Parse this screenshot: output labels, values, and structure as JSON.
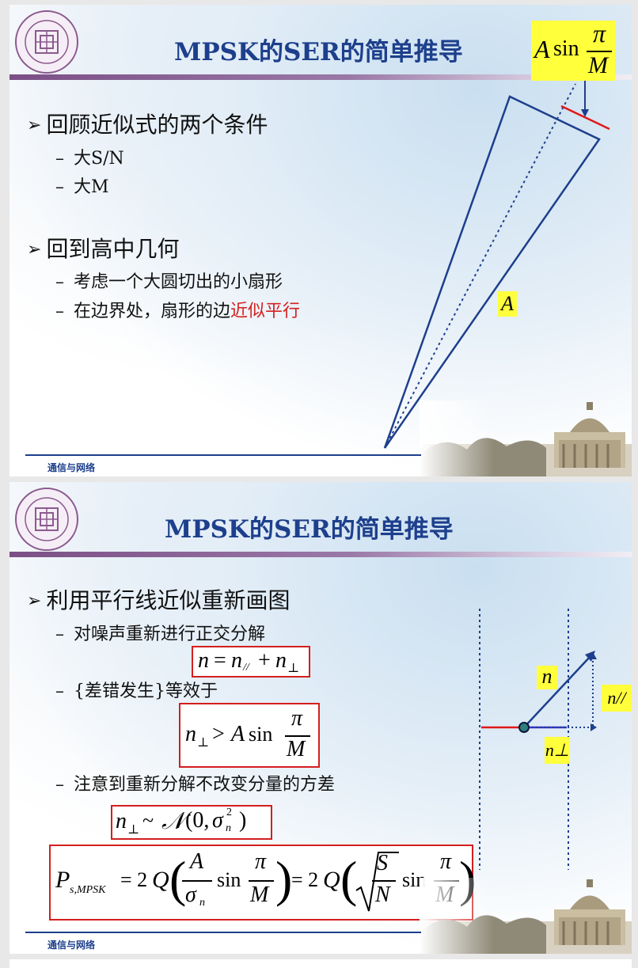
{
  "slide1": {
    "title": "MPSK的SER的简单推导",
    "bullets": [
      {
        "text": "回顾近似式的两个条件",
        "subs": [
          "大S/N",
          "大M"
        ]
      },
      {
        "text": "回到高中几何",
        "subs": [
          "考虑一个大圆切出的小扇形"
        ]
      }
    ],
    "last_sub_prefix": "在边界处，扇形的边",
    "last_sub_highlight": "近似平行",
    "annotation_top": "A sin π/M",
    "label_A": "A",
    "footer": "通信与网络"
  },
  "slide2": {
    "title": "MPSK的SER的简单推导",
    "bullet": "利用平行线近似重新画图",
    "subs": [
      "对噪声重新进行正交分解",
      "{差错发生}等效于",
      "注意到重新分解不改变分量的方差"
    ],
    "eq1": "n = n// + n⊥",
    "eq2": "n⊥ > A sin π/M",
    "eq3": "n⊥ ~ N(0, σn²)",
    "eq4": "Ps,MPSK = 2Q(A/σn sin π/M) = 2Q(√(S/N) sin π/M)",
    "vec_n": "n",
    "vec_npar": "n//",
    "vec_nperp": "n⊥",
    "footer": "通信与网络"
  },
  "colors": {
    "title": "#1d3f8c",
    "highlight": "#d42020",
    "annotation_bg": "#ffff3c",
    "wedge": "#1d3f8c"
  },
  "icons": {
    "logo": "university-seal-logo",
    "bullet": "arrow-bullet-icon"
  }
}
